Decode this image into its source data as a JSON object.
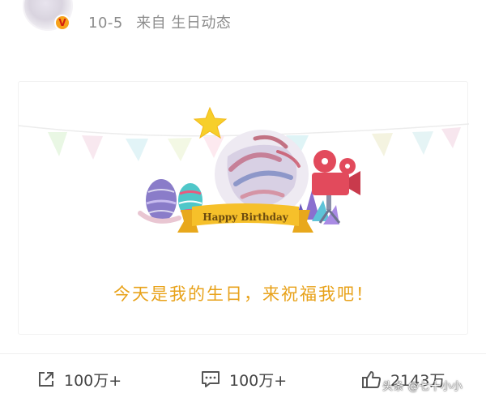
{
  "post": {
    "date": "10-5",
    "source": "来自 生日动态",
    "verified_mark": "V"
  },
  "card": {
    "banner_text": "Happy Birthday",
    "wish": "今天是我的生日，来祝福我吧！"
  },
  "actions": {
    "share": {
      "count": "100万+",
      "icon": "share-icon"
    },
    "comment": {
      "count": "100万+",
      "icon": "comment-icon"
    },
    "like": {
      "count": "2143万",
      "icon": "thumbs-up-icon"
    }
  },
  "watermark": "头条 @七十小小",
  "colors": {
    "wish_text": "#e8a21a",
    "meta_text": "#8c8c8c",
    "badge": "#f7a21b",
    "ribbon": "#f6c02a"
  }
}
